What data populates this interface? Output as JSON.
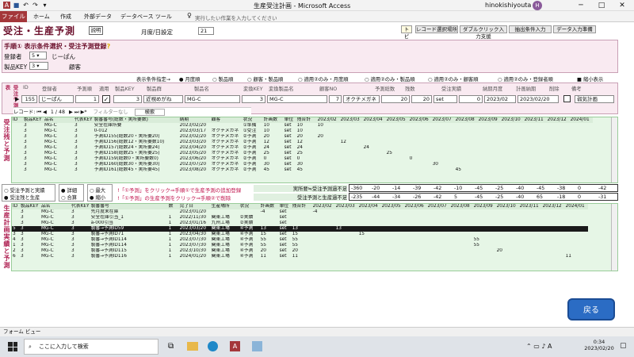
{
  "window": {
    "title": "生産受注計画 - Microsoft Access",
    "user": "hinokishiyouta",
    "user_initial": "H"
  },
  "ribbon": {
    "file": "ファイル",
    "tabs": [
      "ホーム",
      "作成",
      "外部データ",
      "データベース ツール"
    ],
    "help_placeholder": "実行したい作業を入力してください"
  },
  "header": {
    "title": "受注・生産予測",
    "help_btn": "説明",
    "date_label": "月度/日設定",
    "date_value": "21",
    "buttons": [
      "トピック",
      "レコード選択場所",
      "ダブルクリック入力支援",
      "抽出条件入力",
      "データ入力準備"
    ]
  },
  "panel": {
    "heading": "手順① 表示条件選択・受注予測登録",
    "heading_q": "?",
    "reg_label": "登録者",
    "reg_value": "5",
    "reg_name": "じーぱん",
    "key_label": "製品KEY",
    "key_value": "3",
    "key_extra": "顧客"
  },
  "cond": {
    "label": "表示条件指定→",
    "options": [
      "月度順",
      "製品順",
      "顧客・製品順",
      "適用②のみ・月度順",
      "適用②のみ・製品順",
      "適用②のみ・顧客順",
      "適用②のみ・登録者順",
      "縮小表示"
    ]
  },
  "entry": {
    "side_label": "受注予測表",
    "headers": [
      "ID",
      "登録者",
      "予測順",
      "適用",
      "製品KEY",
      "製品群",
      "製品名",
      "変換KEY",
      "変換製品名",
      "顧客NO",
      "予測総数",
      "残数",
      "受注実績",
      "納期月度",
      "計画納期",
      "削除",
      "備考"
    ],
    "values": [
      "155",
      "じーぱん",
      "1",
      "3",
      "近視めがね",
      "MG-C",
      "3",
      "MG-C",
      "7",
      "オクチメガネ",
      "20",
      "20",
      "set",
      "0",
      "2023/02",
      "2023/02/20",
      "弱気計画"
    ],
    "nav_label": "レコード:",
    "nav_pos": "1 / 48",
    "nav_filter": "フィルターなし",
    "nav_search": "検索"
  },
  "grid1": {
    "side_label": "受注残と予測",
    "headers": [
      "ID",
      "製品KEY",
      "品名",
      "代表KEY",
      "製番番号(総数・実所要数)",
      "納期",
      "顧客",
      "状況",
      "計画数",
      "単位",
      "残合計",
      "2023/02",
      "2023/03",
      "2023/04",
      "2023/05",
      "2023/06",
      "2023/07",
      "2023/08",
      "2023/09",
      "2023/10",
      "2023/11",
      "2023/12",
      "2024/01"
    ],
    "rows": [
      [
        "",
        "3",
        "MG-C",
        "3",
        "安全在庫所要",
        "2023/02/20",
        "",
        "①準備",
        "10",
        "set",
        "10",
        "10",
        "",
        "",
        "",
        "",
        "",
        "",
        "",
        "",
        "",
        "",
        ""
      ],
      [
        "",
        "3",
        "MG-C",
        "3",
        "0-012",
        "2023/03/17",
        "オクチメガネ",
        "①受注",
        "10",
        "set",
        "10",
        "",
        "",
        "",
        "",
        "",
        "",
        "",
        "",
        "",
        "",
        "",
        ""
      ],
      [
        "",
        "3",
        "MG-C",
        "3",
        "予測ID155(総数20・実所要20)",
        "2023/02/20",
        "オクチメガネ",
        "②予測",
        "20",
        "set",
        "20",
        "20",
        "",
        "",
        "",
        "",
        "",
        "",
        "",
        "",
        "",
        "",
        ""
      ],
      [
        "",
        "3",
        "MG-C",
        "3",
        "予測ID156(総数12・実所要数10)",
        "2023/03/20",
        "オクチメガネ",
        "②予測",
        "12",
        "set",
        "12",
        "",
        "12",
        "",
        "",
        "",
        "",
        "",
        "",
        "",
        "",
        "",
        ""
      ],
      [
        "",
        "3",
        "MG-C",
        "3",
        "予測ID157(総数24・実所要24)",
        "2023/04/20",
        "オクチメガネ",
        "②予測",
        "24",
        "set",
        "24",
        "",
        "",
        "24",
        "",
        "",
        "",
        "",
        "",
        "",
        "",
        "",
        ""
      ],
      [
        "",
        "3",
        "MG-C",
        "3",
        "予測ID158(総数25・実所要25)",
        "2023/05/20",
        "オクチメガネ",
        "②予測",
        "25",
        "set",
        "25",
        "",
        "",
        "",
        "25",
        "",
        "",
        "",
        "",
        "",
        "",
        "",
        ""
      ],
      [
        "",
        "3",
        "MG-C",
        "3",
        "予測ID159(総数0・実所要数0)",
        "2023/06/20",
        "オクチメガネ",
        "②予測",
        "0",
        "set",
        "0",
        "",
        "",
        "",
        "",
        "0",
        "",
        "",
        "",
        "",
        "",
        "",
        ""
      ],
      [
        "",
        "3",
        "MG-C",
        "3",
        "予測ID160(総数30・実所要30)",
        "2023/07/20",
        "オクチメガネ",
        "②予測",
        "30",
        "set",
        "30",
        "",
        "",
        "",
        "",
        "",
        "30",
        "",
        "",
        "",
        "",
        "",
        ""
      ],
      [
        "",
        "3",
        "MG-C",
        "3",
        "予測ID161(総数45・実所要45)",
        "2023/08/20",
        "オクチメガネ",
        "②予測",
        "45",
        "set",
        "45",
        "",
        "",
        "",
        "",
        "",
        "",
        "45",
        "",
        "",
        "",
        "",
        ""
      ]
    ]
  },
  "options": {
    "radio1": "受注予測と実績",
    "radio2": "受注残と生産",
    "detail": "詳細",
    "total": "合算",
    "max": "最大",
    "min": "縮小",
    "note1": "①予測」をクリック⇒手順①で生産予測の追加登録",
    "note2": "①予測」の生産予測をクリック⇒手順②で削除",
    "sum1_label": "実所要≒受注予測過不足",
    "sum1": [
      "-360",
      "-20",
      "-14",
      "-39",
      "-42",
      "-10",
      "-45",
      "-25",
      "-40",
      "-45",
      "-38",
      "0",
      "-42"
    ],
    "sum2_label": "受注予測と生産過不足",
    "sum2": [
      "-235",
      "-44",
      "-34",
      "-26",
      "-42",
      "5",
      "-45",
      "-25",
      "-40",
      "65",
      "-18",
      "0",
      "-31"
    ]
  },
  "grid2": {
    "side_label": "生産計画実績と予測",
    "headers": [
      "ID",
      "製品KEY",
      "品名",
      "代表KEY",
      "製番番号",
      "数",
      "完了日",
      "生産場所",
      "状況",
      "計画数",
      "単位",
      "残合計",
      "2023/02",
      "2023/03",
      "2023/04",
      "2023/05",
      "2023/06",
      "2023/07",
      "2023/08",
      "2023/09",
      "2023/10",
      "2023/11",
      "2023/12",
      "2024/01"
    ],
    "rows": [
      [
        "",
        "3",
        "MG-C",
        "3",
        "先月度末在庫",
        "",
        "2023/01/20",
        "",
        "",
        "-4",
        "set",
        "",
        "-4",
        "",
        "",
        "",
        "",
        "",
        "",
        "",
        "",
        "",
        "",
        ""
      ],
      [
        "",
        "3",
        "MG-C",
        "3",
        "安全在庫引当_1",
        "1",
        "2022/11/30",
        "関東工場",
        "②実績",
        "",
        "set",
        "",
        "",
        "",
        "",
        "",
        "",
        "",
        "",
        "",
        "",
        "",
        "",
        ""
      ],
      [
        "",
        "3",
        "MG-C",
        "3",
        "a-000引当",
        "1",
        "2023/01/16",
        "九州工場",
        "②実績",
        "",
        "set",
        "",
        "",
        "",
        "",
        "",
        "",
        "",
        "",
        "",
        "",
        "",
        "",
        ""
      ],
      [
        "5",
        "3",
        "MG-C",
        "3",
        "製番→予測ID59",
        "1",
        "2023/03/20",
        "関東工場",
        "④予測",
        "13",
        "set",
        "13",
        "",
        "13",
        "",
        "",
        "",
        "",
        "",
        "",
        "",
        "",
        "",
        ""
      ],
      [
        "3",
        "3",
        "MG-C",
        "3",
        "製番→予測ID71",
        "1",
        "2023/04/30",
        "関東工場",
        "④予測",
        "15",
        "set",
        "15",
        "",
        "",
        "15",
        "",
        "",
        "",
        "",
        "",
        "",
        "",
        "",
        ""
      ],
      [
        "4",
        "3",
        "MG-C",
        "3",
        "製番→予測ID114",
        "1",
        "2023/07/30",
        "関東工場",
        "④予測",
        "55",
        "set",
        "55",
        "",
        "",
        "",
        "",
        "",
        "",
        "",
        "55",
        "",
        "",
        "",
        ""
      ],
      [
        "1",
        "3",
        "MG-C",
        "3",
        "製番→予測ID114",
        "1",
        "2023/07/30",
        "関東工場",
        "④予測",
        "55",
        "set",
        "55",
        "",
        "",
        "",
        "",
        "",
        "",
        "",
        "55",
        "",
        "",
        "",
        ""
      ],
      [
        "2",
        "3",
        "MG-C",
        "3",
        "製番→予測ID115",
        "1",
        "2023/10/30",
        "関東工場",
        "④予測",
        "20",
        "set",
        "20",
        "",
        "",
        "",
        "",
        "",
        "",
        "",
        "",
        "20",
        "",
        "",
        ""
      ],
      [
        "6",
        "3",
        "MG-C",
        "3",
        "製番→予測ID116",
        "1",
        "2024/01/20",
        "関東工場",
        "④予測",
        "11",
        "set",
        "11",
        "",
        "",
        "",
        "",
        "",
        "",
        "",
        "",
        "",
        "",
        "",
        "11"
      ]
    ]
  },
  "return_btn": "戻る",
  "status": "フォーム ビュー",
  "taskbar": {
    "search": "ここに入力して検索",
    "time": "0:34",
    "date": "2023/02/20",
    "ime": "A"
  }
}
